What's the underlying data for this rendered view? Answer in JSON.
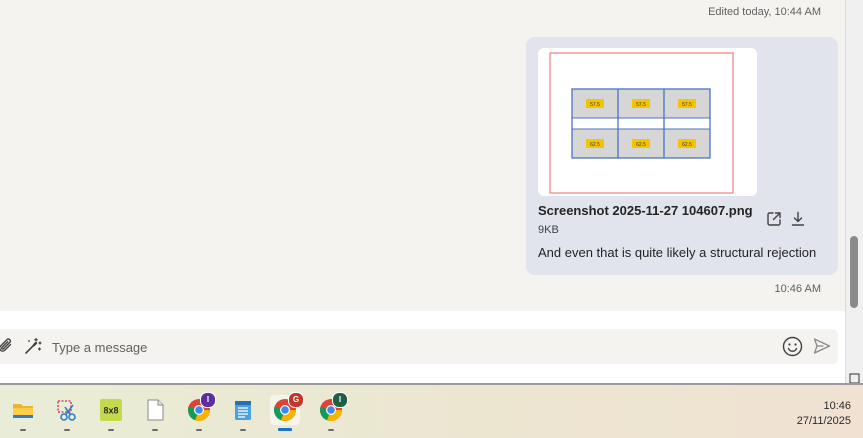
{
  "chat": {
    "edited_label": "Edited today, 10:44 AM",
    "attachment": {
      "filename": "Screenshot 2025-11-27 104607.png",
      "size": "9KB",
      "preview_values_top": [
        "57.5",
        "57.5",
        "57.5"
      ],
      "preview_values_bottom": [
        "62.5",
        "62.5",
        "62.5"
      ]
    },
    "caption": "And even that is quite likely a structural rejection",
    "timestamp": "10:46 AM"
  },
  "composer": {
    "placeholder": "Type a message"
  },
  "taskbar": {
    "badges": {
      "chrome1": "I",
      "chrome2": "G",
      "chrome3": "I"
    },
    "app_8x8_label": "8x8",
    "clock_time": "10:46",
    "clock_date": "27/11/2025"
  },
  "colors": {
    "bubble": "#e1e4ec",
    "accent": "#1a73c8",
    "badge_purple": "#5b2fa0",
    "badge_red": "#c0392b",
    "badge_teal": "#1f5f4a"
  }
}
